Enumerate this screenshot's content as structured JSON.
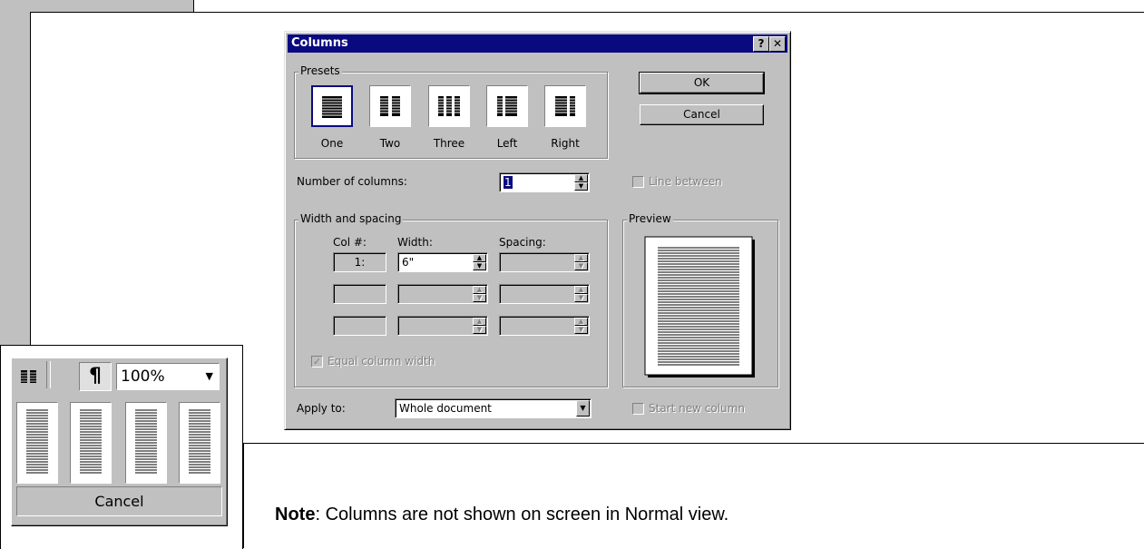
{
  "dialog": {
    "title": "Columns",
    "help_btn": "?",
    "close_btn": "✕",
    "presets": {
      "group_label": "Presets",
      "items": [
        {
          "label": "One",
          "mnemonic": "O"
        },
        {
          "label": "Two",
          "mnemonic": "w"
        },
        {
          "label": "Three",
          "mnemonic": "T"
        },
        {
          "label": "Left",
          "mnemonic": "L"
        },
        {
          "label": "Right",
          "mnemonic": "R"
        }
      ]
    },
    "ok_label": "OK",
    "cancel_label": "Cancel",
    "num_columns_label": "Number of columns:",
    "num_columns_value": "1",
    "line_between_label": "Line between",
    "width_spacing": {
      "group_label": "Width and spacing",
      "col_header": "Col #:",
      "width_header": "Width:",
      "spacing_header": "Spacing:",
      "rows": [
        {
          "col": "1:",
          "width": "6\"",
          "spacing": ""
        },
        {
          "col": "",
          "width": "",
          "spacing": ""
        },
        {
          "col": "",
          "width": "",
          "spacing": ""
        }
      ],
      "equal_width_label": "Equal column width",
      "equal_width_checked": "✓"
    },
    "preview_label": "Preview",
    "apply_to_label": "Apply to:",
    "apply_to_value": "Whole document",
    "start_new_column_label": "Start new column"
  },
  "toolbar": {
    "pilcrow": "¶",
    "zoom_value": "100%",
    "cancel_label": "Cancel"
  },
  "note": {
    "bold": "Note",
    "text": ": Columns are not shown on screen in Normal view."
  }
}
